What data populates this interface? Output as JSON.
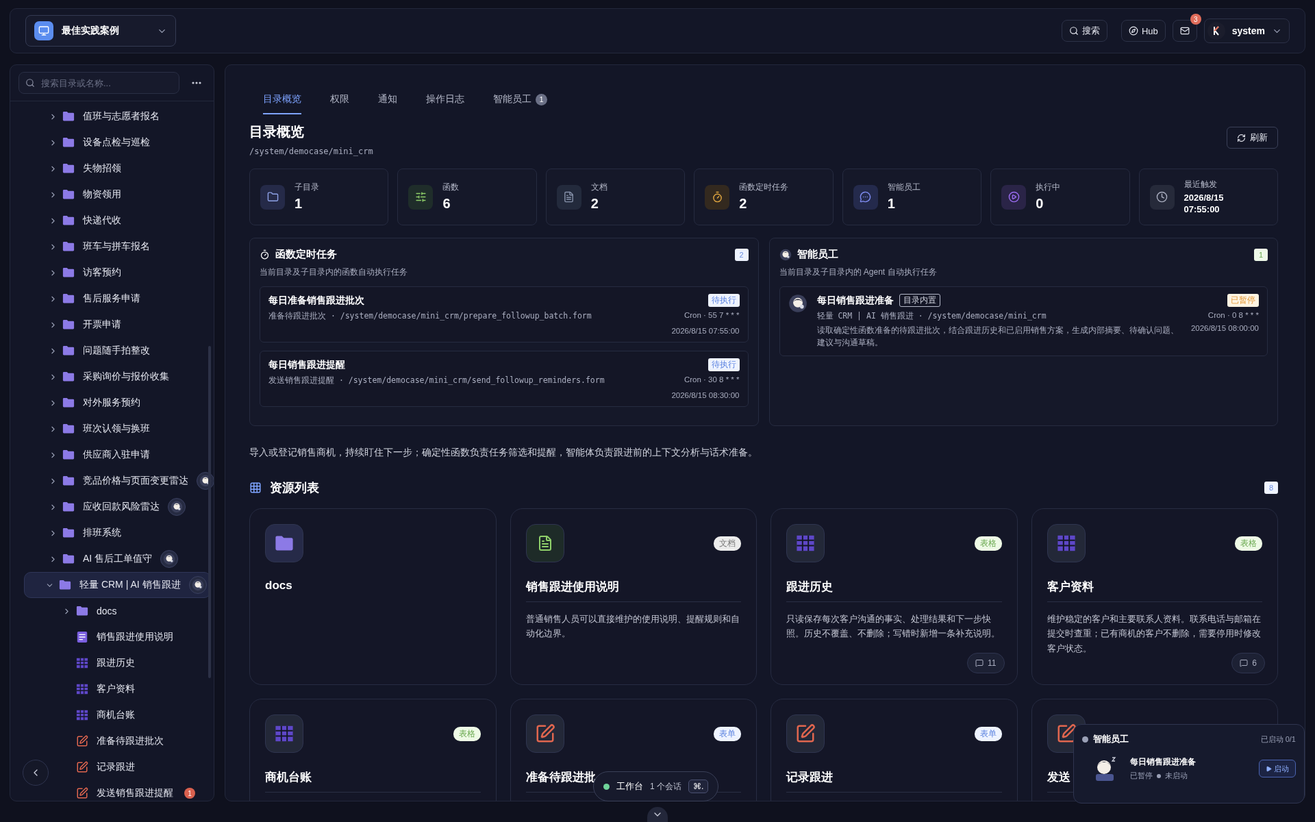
{
  "topbar": {
    "workspace": "最佳实践案例",
    "search": "搜索",
    "hub": "Hub",
    "mail_badge": "3",
    "user": "system"
  },
  "sidebar": {
    "search": {
      "placeholder": "搜索目录或名称..."
    },
    "tree": [
      {
        "label": "值班与志愿者报名",
        "kind": "folder",
        "expanded": false,
        "selected": false,
        "agent": false
      },
      {
        "label": "设备点检与巡检",
        "kind": "folder",
        "expanded": false,
        "selected": false,
        "agent": false
      },
      {
        "label": "失物招领",
        "kind": "folder",
        "expanded": false,
        "selected": false,
        "agent": false
      },
      {
        "label": "物资领用",
        "kind": "folder",
        "expanded": false,
        "selected": false,
        "agent": false
      },
      {
        "label": "快递代收",
        "kind": "folder",
        "expanded": false,
        "selected": false,
        "agent": false
      },
      {
        "label": "班车与拼车报名",
        "kind": "folder",
        "expanded": false,
        "selected": false,
        "agent": false
      },
      {
        "label": "访客预约",
        "kind": "folder",
        "expanded": false,
        "selected": false,
        "agent": false
      },
      {
        "label": "售后服务申请",
        "kind": "folder",
        "expanded": false,
        "selected": false,
        "agent": false
      },
      {
        "label": "开票申请",
        "kind": "folder",
        "expanded": false,
        "selected": false,
        "agent": false
      },
      {
        "label": "问题随手拍整改",
        "kind": "folder",
        "expanded": false,
        "selected": false,
        "agent": false
      },
      {
        "label": "采购询价与报价收集",
        "kind": "folder",
        "expanded": false,
        "selected": false,
        "agent": false
      },
      {
        "label": "对外服务预约",
        "kind": "folder",
        "expanded": false,
        "selected": false,
        "agent": false
      },
      {
        "label": "班次认领与换班",
        "kind": "folder",
        "expanded": false,
        "selected": false,
        "agent": false
      },
      {
        "label": "供应商入驻申请",
        "kind": "folder",
        "expanded": false,
        "selected": false,
        "agent": false
      },
      {
        "label": "竞品价格与页面变更雷达",
        "kind": "folder",
        "expanded": false,
        "selected": false,
        "agent": true
      },
      {
        "label": "应收回款风险雷达",
        "kind": "folder",
        "expanded": false,
        "selected": false,
        "agent": true
      },
      {
        "label": "排班系统",
        "kind": "folder",
        "expanded": false,
        "selected": false,
        "agent": false
      },
      {
        "label": "AI 售后工单值守",
        "kind": "folder",
        "expanded": false,
        "selected": false,
        "agent": true
      },
      {
        "label": "轻量 CRM | AI 销售跟进",
        "kind": "folder",
        "expanded": true,
        "selected": true,
        "agent": true,
        "children": [
          {
            "label": "docs",
            "kind": "folder",
            "expanded": false,
            "selected": false,
            "agent": false
          },
          {
            "label": "销售跟进使用说明",
            "kind": "doc",
            "selected": false,
            "agent": false
          },
          {
            "label": "跟进历史",
            "kind": "table",
            "selected": false,
            "agent": false
          },
          {
            "label": "客户资料",
            "kind": "table",
            "selected": false,
            "agent": false
          },
          {
            "label": "商机台账",
            "kind": "table",
            "selected": false,
            "agent": false
          },
          {
            "label": "准备待跟进批次",
            "kind": "form",
            "selected": false,
            "agent": false
          },
          {
            "label": "记录跟进",
            "kind": "form",
            "selected": false,
            "agent": false
          },
          {
            "label": "发送销售跟进提醒",
            "kind": "form",
            "selected": false,
            "agent": false,
            "badge": "1"
          }
        ]
      }
    ]
  },
  "tabs": [
    {
      "label": "目录概览",
      "selected": true
    },
    {
      "label": "权限",
      "selected": false
    },
    {
      "label": "通知",
      "selected": false
    },
    {
      "label": "操作日志",
      "selected": false
    },
    {
      "label": "智能员工",
      "selected": false,
      "badge": "1"
    }
  ],
  "header": {
    "title": "目录概览",
    "path": "/system/democase/mini_crm",
    "refresh": "刷新"
  },
  "stats": [
    {
      "kind": "folder",
      "label": "子目录",
      "value": "1"
    },
    {
      "kind": "function",
      "label": "函数",
      "value": "6"
    },
    {
      "kind": "doc",
      "label": "文档",
      "value": "2"
    },
    {
      "kind": "timer",
      "label": "函数定时任务",
      "value": "2"
    },
    {
      "kind": "agent",
      "label": "智能员工",
      "value": "1"
    },
    {
      "kind": "running",
      "label": "执行中",
      "value": "0"
    },
    {
      "kind": "clock",
      "label": "最近触发",
      "value": "2026/8/15 07:55:00"
    }
  ],
  "scheduled_tasks": {
    "title": "函数定时任务",
    "count": "2",
    "subtitle": "当前目录及子目录内的函数自动执行任务",
    "items": [
      {
        "title": "每日准备销售跟进批次",
        "status": {
          "label": "待执行",
          "kind": "pending"
        },
        "path": "准备待跟进批次 · /system/democase/mini_crm/prepare_followup_batch.form",
        "cron": "Cron · 55 7 * * *",
        "time": "2026/8/15 07:55:00"
      },
      {
        "title": "每日销售跟进提醒",
        "status": {
          "label": "待执行",
          "kind": "pending"
        },
        "path": "发送销售跟进提醒 · /system/democase/mini_crm/send_followup_reminders.form",
        "cron": "Cron · 30 8 * * *",
        "time": "2026/8/15 08:30:00"
      }
    ]
  },
  "agents": {
    "title": "智能员工",
    "count": "1",
    "subtitle": "当前目录及子目录内的 Agent 自动执行任务",
    "items": [
      {
        "title": "每日销售跟进准备",
        "tag": "目录内置",
        "status": {
          "label": "已暂停",
          "kind": "paused"
        },
        "path": "轻量 CRM | AI 销售跟进 · /system/democase/mini_crm",
        "cron": "Cron · 0 8 * * *",
        "description": "读取确定性函数准备的待跟进批次，结合跟进历史和已启用销售方案，生成内部摘要、待确认问题、建议与沟通草稿。",
        "time": "2026/8/15 08:00:00"
      }
    ]
  },
  "description": "导入或登记销售商机，持续盯住下一步；确定性函数负责任务筛选和提醒，智能体负责跟进前的上下文分析与话术准备。",
  "resources": {
    "title": "资源列表",
    "count": "8",
    "items": [
      {
        "kind": "folder",
        "title": "docs"
      },
      {
        "kind": "doc",
        "tag": "文档",
        "title": "销售跟进使用说明",
        "description": "普通销售人员可以直接维护的使用说明、提醒规则和自动化边界。"
      },
      {
        "kind": "table",
        "tag": "表格",
        "title": "跟进历史",
        "description": "只读保存每次客户沟通的事实、处理结果和下一步快照。历史不覆盖、不删除；写错时新增一条补充说明。",
        "comments": "11"
      },
      {
        "kind": "table",
        "tag": "表格",
        "title": "客户资料",
        "description": "维护稳定的客户和主要联系人资料。联系电话与邮箱在提交时查重；已有商机的客户不删除，需要停用时修改客户状态。",
        "comments": "6"
      },
      {
        "kind": "table",
        "tag": "表格",
        "title": "商机台账"
      },
      {
        "kind": "form",
        "tag": "表单",
        "title": "准备待跟进批"
      },
      {
        "kind": "form",
        "tag": "表单",
        "title": "记录跟进"
      },
      {
        "kind": "form",
        "title": "发送"
      }
    ]
  },
  "workbench": {
    "label": "工作台",
    "sessions": "1 个会话",
    "shortcut": "⌘."
  },
  "agent_widget": {
    "title": "智能员工",
    "summary": "已启动 0/1",
    "item": {
      "title": "每日销售跟进准备",
      "state": "已暂停",
      "run_state": "未启动",
      "running": false
    },
    "button": "启动"
  }
}
